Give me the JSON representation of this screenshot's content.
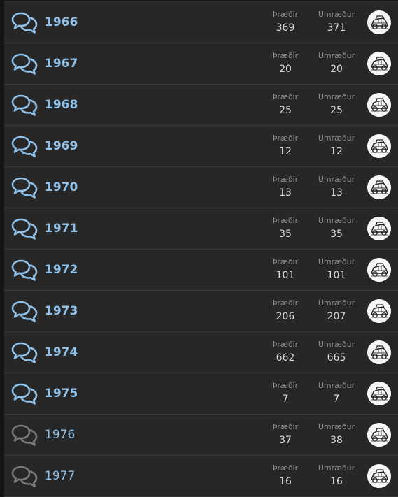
{
  "colors": {
    "unread_icon": "#8fc1ea",
    "read_icon": "#7a7a7a",
    "title": "#8fc1ea",
    "label": "#8f8f8f",
    "value": "#dcdcdc",
    "row_bg": "#272727"
  },
  "stat_labels": {
    "threads": "Þræðir",
    "messages": "Umræður"
  },
  "forums": [
    {
      "title": "1966",
      "threads": "369",
      "messages": "371",
      "unread": true,
      "icon": "chat-bubbles-icon"
    },
    {
      "title": "1967",
      "threads": "20",
      "messages": "20",
      "unread": true,
      "icon": "chat-bubbles-icon"
    },
    {
      "title": "1968",
      "threads": "25",
      "messages": "25",
      "unread": true,
      "icon": "chat-bubbles-icon"
    },
    {
      "title": "1969",
      "threads": "12",
      "messages": "12",
      "unread": true,
      "icon": "chat-bubbles-icon"
    },
    {
      "title": "1970",
      "threads": "13",
      "messages": "13",
      "unread": true,
      "icon": "chat-bubbles-icon"
    },
    {
      "title": "1971",
      "threads": "35",
      "messages": "35",
      "unread": true,
      "icon": "chat-bubbles-icon"
    },
    {
      "title": "1972",
      "threads": "101",
      "messages": "101",
      "unread": true,
      "icon": "chat-bubbles-icon"
    },
    {
      "title": "1973",
      "threads": "206",
      "messages": "207",
      "unread": true,
      "icon": "chat-bubbles-icon"
    },
    {
      "title": "1974",
      "threads": "662",
      "messages": "665",
      "unread": true,
      "icon": "chat-bubbles-icon"
    },
    {
      "title": "1975",
      "threads": "7",
      "messages": "7",
      "unread": true,
      "icon": "chat-bubbles-icon"
    },
    {
      "title": "1976",
      "threads": "37",
      "messages": "38",
      "unread": false,
      "icon": "chat-bubbles-icon"
    },
    {
      "title": "1977",
      "threads": "16",
      "messages": "16",
      "unread": false,
      "icon": "chat-bubbles-icon"
    }
  ]
}
